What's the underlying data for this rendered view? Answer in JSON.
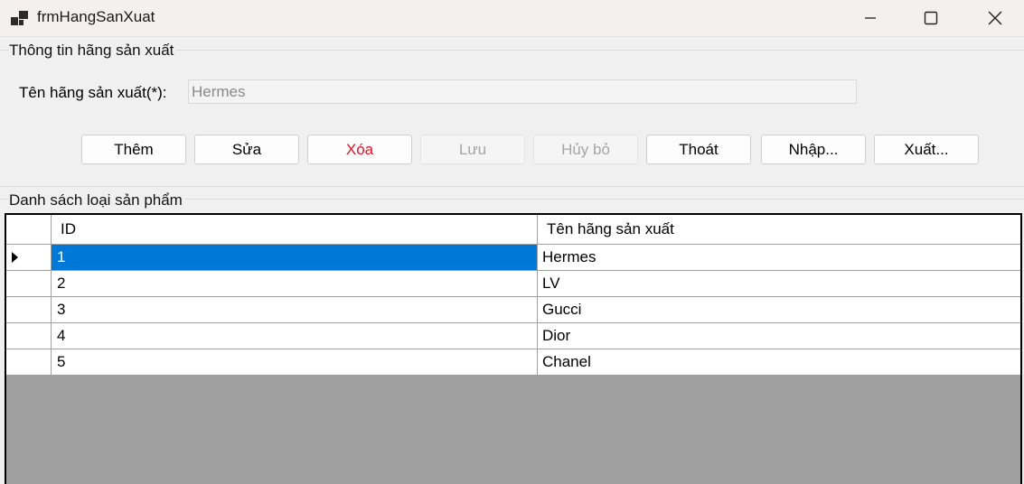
{
  "window": {
    "title": "frmHangSanXuat",
    "icon": "app-window-icon",
    "controls": [
      "minimize-icon",
      "maximize-icon",
      "close-icon"
    ]
  },
  "info_group": {
    "title": "Thông tin hãng sản xuất",
    "field_label": "Tên hãng sản xuất(*):",
    "field_value": "Hermes"
  },
  "buttons": {
    "add": "Thêm",
    "edit": "Sửa",
    "delete": "Xóa",
    "save": "Lưu",
    "cancel": "Hủy bỏ",
    "exit": "Thoát",
    "import": "Nhập...",
    "export": "Xuất..."
  },
  "list_group": {
    "title": "Danh sách loại sản phẩm"
  },
  "grid": {
    "columns": [
      "ID",
      "Tên hãng sản xuất"
    ],
    "rows": [
      {
        "id": "1",
        "name": "Hermes"
      },
      {
        "id": "2",
        "name": "LV"
      },
      {
        "id": "3",
        "name": "Gucci"
      },
      {
        "id": "4",
        "name": "Dior"
      },
      {
        "id": "5",
        "name": "Chanel"
      }
    ],
    "selected_row_index": 0
  },
  "colors": {
    "selection": "#0078d7",
    "danger_text": "#e81123",
    "empty_grid_area": "#a0a0a0"
  }
}
